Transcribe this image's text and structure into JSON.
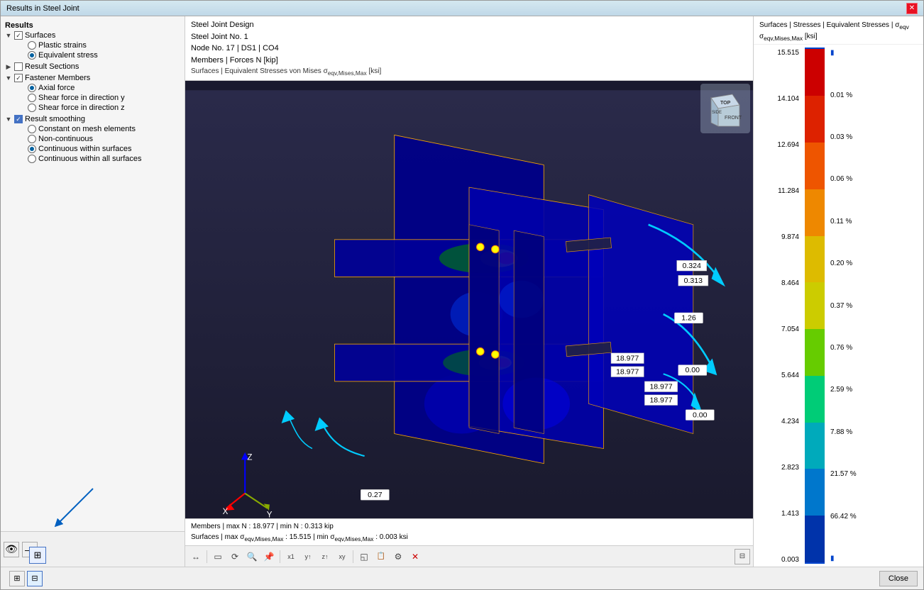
{
  "window": {
    "title": "Results in Steel Joint",
    "close_label": "✕"
  },
  "left_panel": {
    "results_label": "Results",
    "tree": [
      {
        "id": "surfaces",
        "type": "expand-check",
        "label": "Surfaces",
        "level": 0,
        "checked": true,
        "expanded": true
      },
      {
        "id": "plastic-strains",
        "type": "radio",
        "label": "Plastic strains",
        "level": 1,
        "selected": false
      },
      {
        "id": "equivalent-stress",
        "type": "radio",
        "label": "Equivalent stress",
        "level": 1,
        "selected": true
      },
      {
        "id": "result-sections",
        "type": "expand-check",
        "label": "Result Sections",
        "level": 0,
        "checked": false,
        "expanded": false
      },
      {
        "id": "fastener-members",
        "type": "expand-check",
        "label": "Fastener Members",
        "level": 0,
        "checked": true,
        "expanded": true
      },
      {
        "id": "axial-force",
        "type": "radio",
        "label": "Axial force",
        "level": 1,
        "selected": true
      },
      {
        "id": "shear-y",
        "type": "radio",
        "label": "Shear force in direction y",
        "level": 1,
        "selected": false
      },
      {
        "id": "shear-z",
        "type": "radio",
        "label": "Shear force in direction z",
        "level": 1,
        "selected": false
      },
      {
        "id": "result-smoothing",
        "type": "expand-check",
        "label": "Result smoothing",
        "level": 0,
        "checked": false,
        "expanded": true
      },
      {
        "id": "constant-mesh",
        "type": "radio",
        "label": "Constant on mesh elements",
        "level": 1,
        "selected": false
      },
      {
        "id": "non-continuous",
        "type": "radio",
        "label": "Non-continuous",
        "level": 1,
        "selected": false
      },
      {
        "id": "continuous-surfaces",
        "type": "radio",
        "label": "Continuous within surfaces",
        "level": 1,
        "selected": true
      },
      {
        "id": "continuous-all",
        "type": "radio",
        "label": "Continuous within all surfaces",
        "level": 1,
        "selected": false
      }
    ]
  },
  "center": {
    "header_lines": [
      "Steel Joint Design",
      "Steel Joint No. 1",
      "Node No. 17 | DS1 | CO4",
      "Members | Forces N [kip]"
    ],
    "subtitle": "Surfaces | Equivalent Stresses von Mises σeqv,Mises,Max [ksi]",
    "bottom_lines": [
      "Members | max N : 18.977 | min N : 0.313 kip",
      "Surfaces | max σeqv,Mises,Max : 15.515 | min σeqv,Mises,Max : 0.003 ksi"
    ]
  },
  "toolbar": {
    "buttons": [
      "↔",
      "⟲",
      "🔍",
      "📌",
      "⊕",
      "x1",
      "y↑",
      "z↑",
      "xy",
      "◱",
      "📋",
      "⚡",
      "✕"
    ]
  },
  "legend": {
    "title": "Surfaces | Stresses | Equivalent Stresses | σeqv",
    "subtitle": "σeqv,Mises,Max [ksi]",
    "values": [
      "15.515",
      "14.104",
      "12.694",
      "11.284",
      "9.874",
      "8.464",
      "7.054",
      "5.644",
      "4.234",
      "2.823",
      "1.413",
      "0.003"
    ],
    "percentages": [
      "0.01 %",
      "0.03 %",
      "0.06 %",
      "0.11 %",
      "0.20 %",
      "0.37 %",
      "0.76 %",
      "2.59 %",
      "7.88 %",
      "21.57 %",
      "66.42 %"
    ],
    "colors": [
      "#cc0000",
      "#dd2200",
      "#ee4400",
      "#ee7700",
      "#ddaa00",
      "#cccc00",
      "#88cc00",
      "#00bb55",
      "#00aaaa",
      "#0088cc",
      "#0055bb",
      "#003399"
    ],
    "top_marker": "▮",
    "bottom_marker": "▮"
  },
  "status_bar": {
    "close_label": "Close"
  }
}
